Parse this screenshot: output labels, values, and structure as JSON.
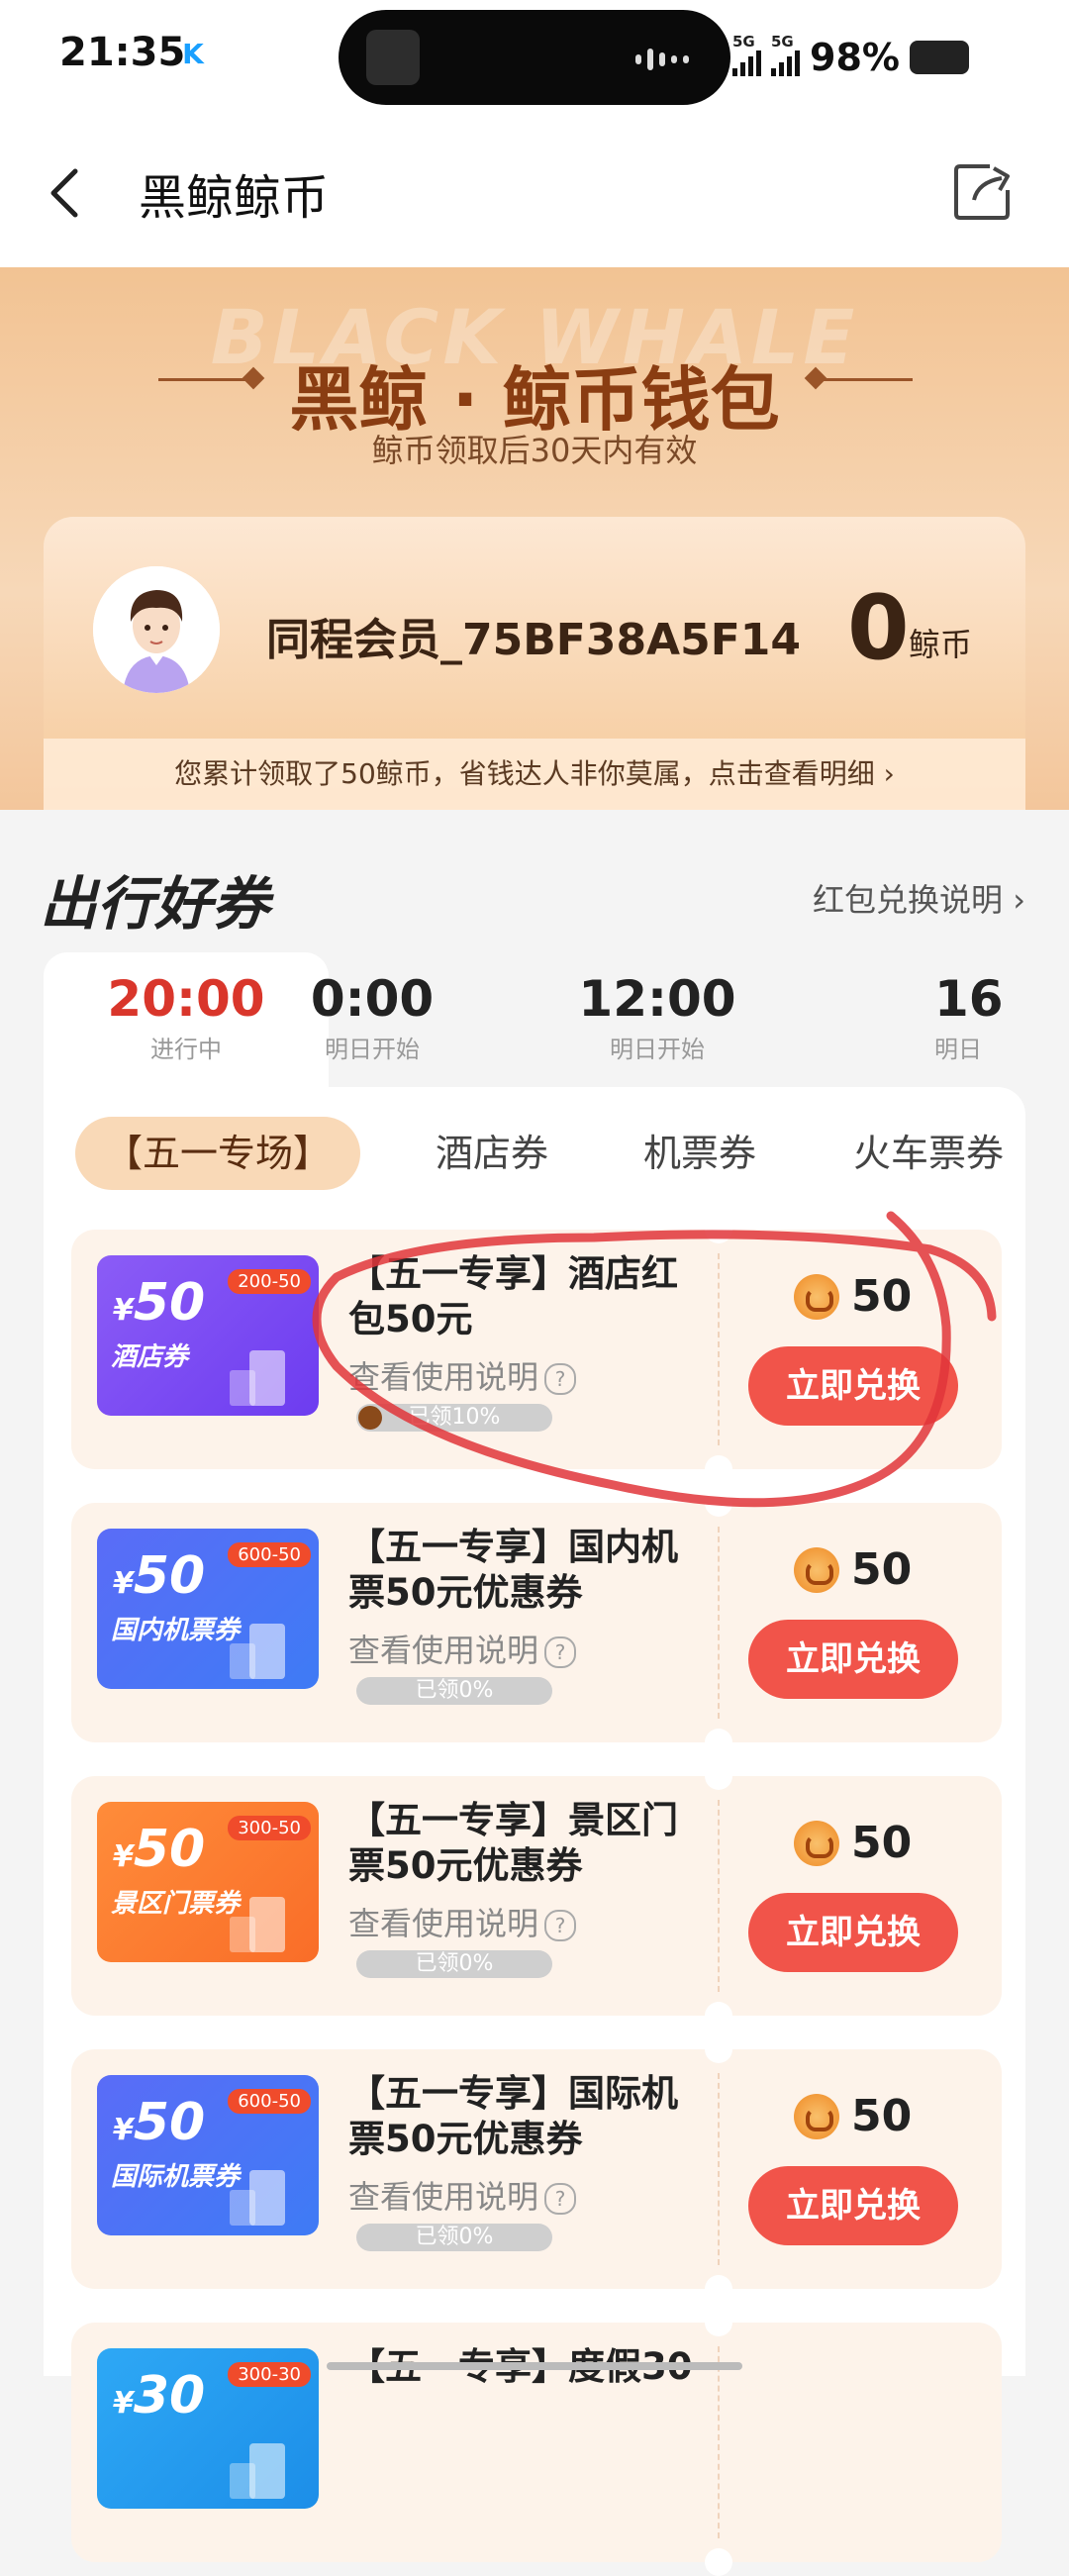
{
  "status_bar": {
    "time": "21:35",
    "app_badge": "K",
    "battery": "98%",
    "network1": "5G",
    "network2": "5G"
  },
  "nav": {
    "title": "黑鲸鲸币"
  },
  "hero": {
    "bg_text": "BLACK WHALE",
    "title": "黑鲸 · 鲸币钱包",
    "subtitle": "鲸币领取后30天内有效"
  },
  "member": {
    "name": "同程会员_75BF38A5F14",
    "coins": "0",
    "coin_unit": "鲸币",
    "notice": "您累计领取了50鲸币，省钱达人非你莫属，点击查看明细 ›"
  },
  "section": {
    "title": "出行好券",
    "link": "红包兑换说明 ›"
  },
  "time_tabs": [
    {
      "time": "20:00",
      "status": "进行中"
    },
    {
      "time": "0:00",
      "status": "明日开始"
    },
    {
      "time": "12:00",
      "status": "明日开始"
    },
    {
      "time": "16",
      "status": "明日"
    }
  ],
  "category_tabs": [
    "【五一专场】",
    "酒店券",
    "机票券",
    "火车票券"
  ],
  "coupons": [
    {
      "amount": "50",
      "currency": "¥",
      "label": "酒店券",
      "badge": "200-50",
      "title": "【五一专享】酒店红包50元",
      "usage": "查看使用说明",
      "progress": "已领10%",
      "points": "50",
      "button": "立即兑换",
      "color1": "#8b5cf6",
      "color2": "#6d3cf0"
    },
    {
      "amount": "50",
      "currency": "¥",
      "label": "国内机票券",
      "badge": "600-50",
      "title": "【五一专享】国内机票50元优惠券",
      "usage": "查看使用说明",
      "progress": "已领0%",
      "points": "50",
      "button": "立即兑换",
      "color1": "#5a6cf7",
      "color2": "#3e7bf5"
    },
    {
      "amount": "50",
      "currency": "¥",
      "label": "景区门票券",
      "badge": "300-50",
      "title": "【五一专享】景区门票50元优惠券",
      "usage": "查看使用说明",
      "progress": "已领0%",
      "points": "50",
      "button": "立即兑换",
      "color1": "#ff8c3a",
      "color2": "#f96d28"
    },
    {
      "amount": "50",
      "currency": "¥",
      "label": "国际机票券",
      "badge": "600-50",
      "title": "【五一专享】国际机票50元优惠券",
      "usage": "查看使用说明",
      "progress": "已领0%",
      "points": "50",
      "button": "立即兑换",
      "color1": "#5a6cf7",
      "color2": "#3e7bf5"
    },
    {
      "amount": "30",
      "currency": "¥",
      "label": "",
      "badge": "300-30",
      "title": "【五一专享】度假30",
      "usage": "",
      "progress": "",
      "points": "",
      "button": "",
      "color1": "#2ea8f5",
      "color2": "#1c8ee8"
    }
  ],
  "colors": {
    "accent_red": "#f1544a",
    "active_time": "#d9362b",
    "brand_brown": "#8a3d12",
    "annotation": "#e0353a"
  }
}
